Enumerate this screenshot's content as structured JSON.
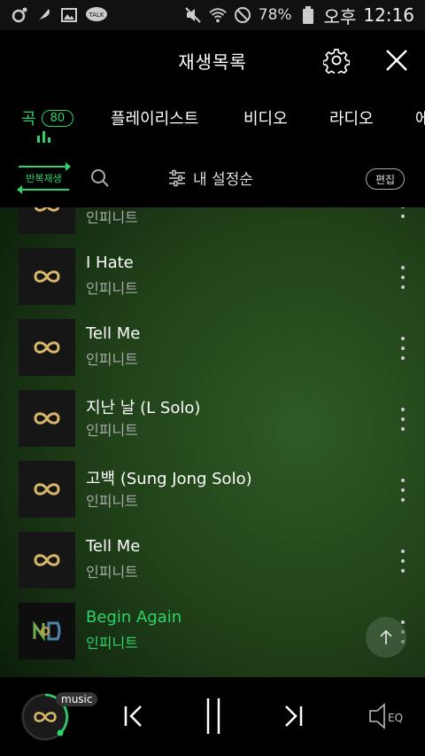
{
  "status_bar": {
    "battery": "78%",
    "ampm": "오후",
    "time": "12:16",
    "talk_label": "TALK"
  },
  "header": {
    "title": "재생목록"
  },
  "tabs": [
    {
      "label": "곡",
      "count": "80"
    },
    {
      "label": "플레이리스트"
    },
    {
      "label": "비디오"
    },
    {
      "label": "라디오"
    },
    {
      "label": "에"
    }
  ],
  "toolbar": {
    "repeat_label": "반복재생",
    "sort_label": "내 설정순",
    "edit_label": "편집"
  },
  "songs": [
    {
      "title": "",
      "artist": "인피니트"
    },
    {
      "title": "I Hate",
      "artist": "인피니트"
    },
    {
      "title": "Tell Me",
      "artist": "인피니트"
    },
    {
      "title": "지난 날 (L Solo)",
      "artist": "인피니트"
    },
    {
      "title": "고백 (Sung Jong Solo)",
      "artist": "인피니트"
    },
    {
      "title": "Tell Me",
      "artist": "인피니트"
    },
    {
      "title": "Begin Again",
      "artist": "인피니트"
    }
  ],
  "player": {
    "badge": "music",
    "eq_label": "EQ"
  },
  "colors": {
    "accent": "#2fd36b",
    "logo_gold": "#d8b66a"
  }
}
